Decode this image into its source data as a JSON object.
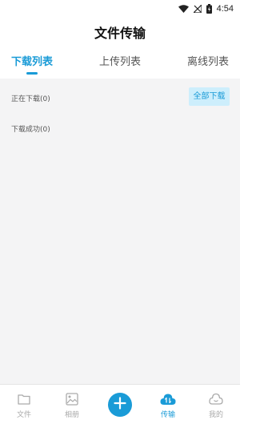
{
  "status_bar": {
    "time": "4:54"
  },
  "page_title": "文件传输",
  "tabs": [
    {
      "label": "下载列表",
      "active": true
    },
    {
      "label": "上传列表",
      "active": false
    },
    {
      "label": "离线列表",
      "active": false
    }
  ],
  "sections": {
    "downloading": "正在下载(0)",
    "downloaded": "下载成功(0)",
    "download_all_button": "全部下载"
  },
  "bottom_nav": [
    {
      "label": "文件",
      "icon": "folder-icon",
      "active": false
    },
    {
      "label": "相册",
      "icon": "image-icon",
      "active": false
    },
    {
      "label": "",
      "icon": "plus-icon",
      "active": false
    },
    {
      "label": "传输",
      "icon": "cloud-transfer-icon",
      "active": true
    },
    {
      "label": "我的",
      "icon": "smile-icon",
      "active": false
    }
  ],
  "colors": {
    "accent": "#1a9bd7",
    "content_bg": "#f4f4f5",
    "button_bg": "#cdeefc"
  }
}
